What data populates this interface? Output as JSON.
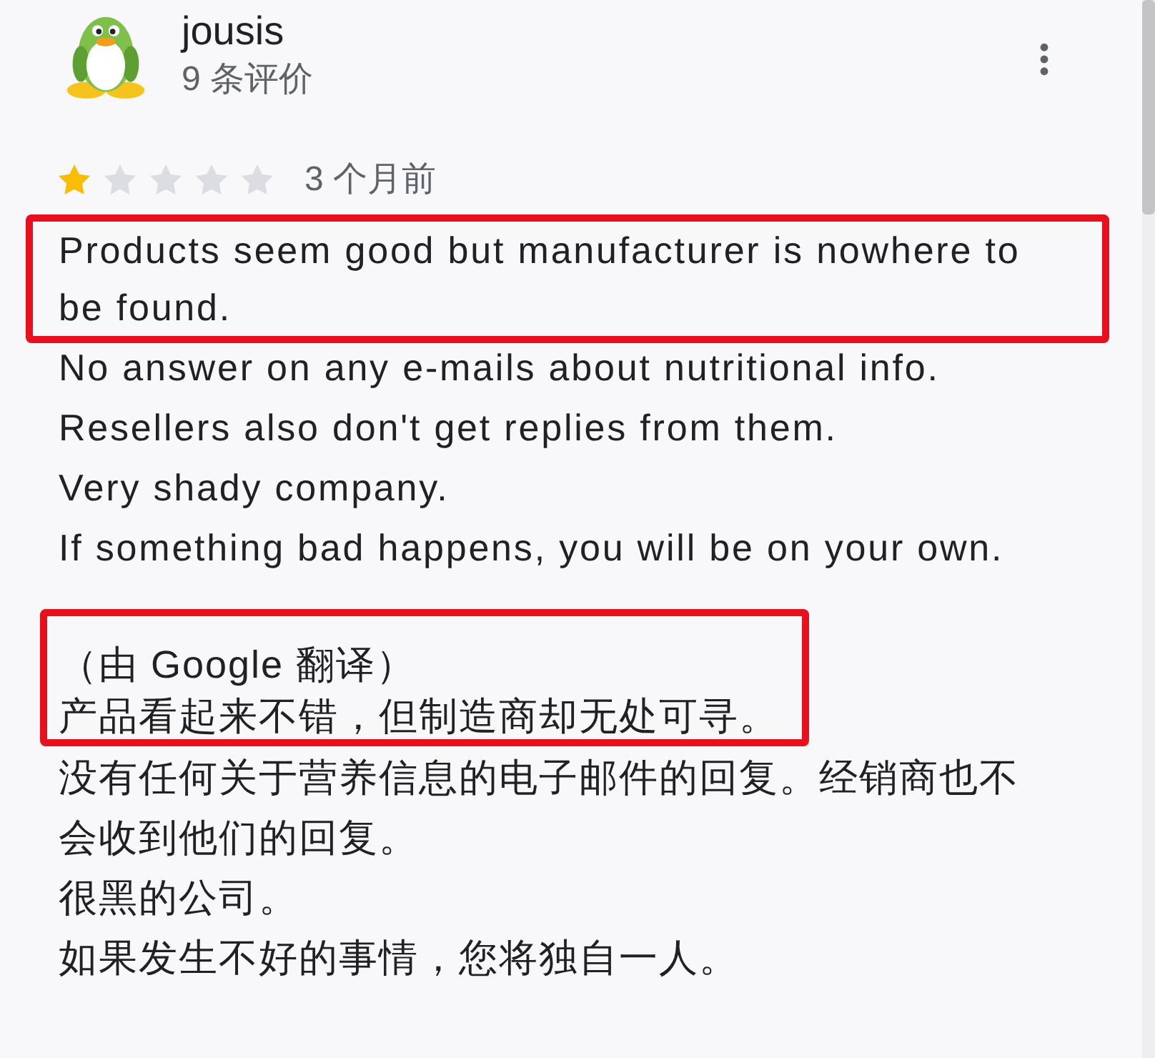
{
  "reviewer": {
    "name": "jousis",
    "review_count": "9 条评价"
  },
  "review": {
    "stars": 1,
    "date": "3 个月前",
    "original_groups": [
      {
        "highlighted": true,
        "lines": [
          "Products seem good but manufacturer is nowhere to be found."
        ]
      },
      {
        "highlighted": false,
        "lines": [
          "No answer on any e-mails about nutritional info.",
          "Resellers also don't get replies from them.",
          "Very shady company.",
          "If something bad happens, you will be on your own."
        ]
      }
    ],
    "translated_groups": [
      {
        "highlighted": true,
        "note": "（由 Google 翻译）",
        "lines": [
          "产品看起来不错，但制造商却无处可寻。"
        ]
      },
      {
        "highlighted": false,
        "lines": [
          "没有任何关于营养信息的电子邮件的回复。经销商也不会收到他们的回复。",
          "很黑的公司。",
          "如果发生不好的事情，您将独自一人。"
        ]
      }
    ]
  }
}
